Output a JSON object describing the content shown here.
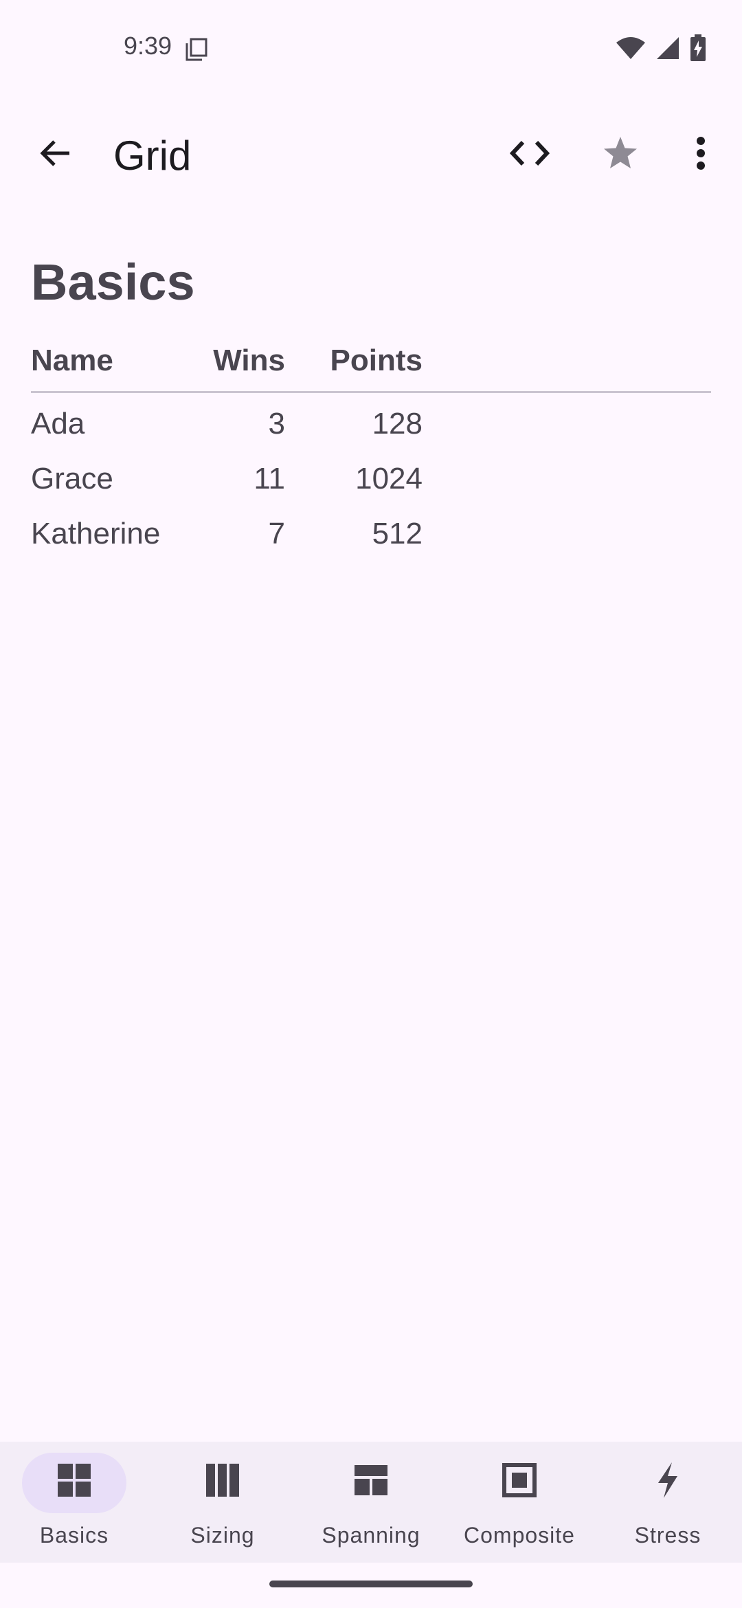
{
  "status_bar": {
    "time": "9:39"
  },
  "app_bar": {
    "title": "Grid"
  },
  "section": {
    "title": "Basics"
  },
  "table": {
    "headers": [
      "Name",
      "Wins",
      "Points"
    ],
    "rows": [
      {
        "name": "Ada",
        "wins": "3",
        "points": "128"
      },
      {
        "name": "Grace",
        "wins": "11",
        "points": "1024"
      },
      {
        "name": "Katherine",
        "wins": "7",
        "points": "512"
      }
    ]
  },
  "bottom_nav": {
    "items": [
      {
        "label": "Basics",
        "icon": "grid-icon",
        "active": true
      },
      {
        "label": "Sizing",
        "icon": "columns-icon",
        "active": false
      },
      {
        "label": "Spanning",
        "icon": "spanning-icon",
        "active": false
      },
      {
        "label": "Composite",
        "icon": "composite-icon",
        "active": false
      },
      {
        "label": "Stress",
        "icon": "bolt-icon",
        "active": false
      }
    ]
  },
  "colors": {
    "background": "#FEF7FF",
    "nav_background": "#F3EDF7",
    "active_indicator": "#E8DEF8",
    "text": "#49454F"
  }
}
